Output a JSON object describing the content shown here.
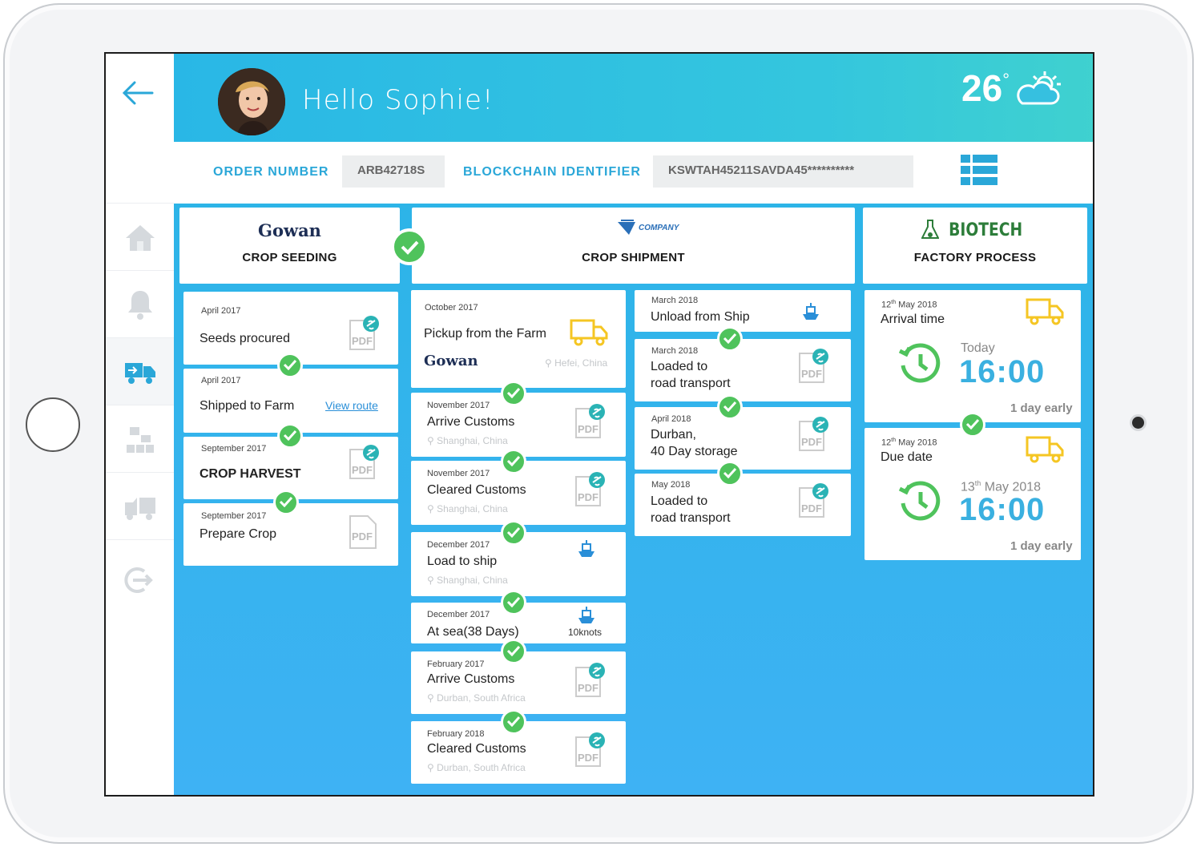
{
  "header": {
    "greeting": "Hello Sophie!",
    "temperature": "26",
    "degree_symbol": "°"
  },
  "order": {
    "order_label": "ORDER NUMBER",
    "order_value": "ARB42718S",
    "chain_label": "BLOCKCHAIN IDENTIFIER",
    "chain_value": "KSWTAH45211SAVDA45**********"
  },
  "columns": {
    "seeding": {
      "logo": "Gowan",
      "title": "CROP SEEDING"
    },
    "shipment": {
      "logo": "COMPANY",
      "title": "CROP SHIPMENT"
    },
    "factory": {
      "logo": "BIOTECH",
      "title": "FACTORY PROCESS"
    }
  },
  "seeding_cards": [
    {
      "date": "April 2017",
      "title": "Seeds procured"
    },
    {
      "date": "April 2017",
      "title": "Shipped to Farm",
      "link": "View route"
    },
    {
      "date": "September 2017",
      "title": "CROP HARVEST"
    },
    {
      "date": "September 2017",
      "title": "Prepare Crop"
    }
  ],
  "shipment_cards": [
    {
      "date": "October 2017",
      "title": "Pickup from the Farm",
      "logo": "Gowan",
      "location": "Hefei, China"
    },
    {
      "date": "November 2017",
      "title": "Arrive Customs",
      "location": "Shanghai, China"
    },
    {
      "date": "November 2017",
      "title": "Cleared Customs",
      "location": "Shanghai, China"
    },
    {
      "date": "December 2017",
      "title": "Load to ship",
      "location": "Shanghai, China"
    },
    {
      "date": "December 2017",
      "title": "At sea(38 Days)",
      "speed": "10knots"
    },
    {
      "date": "February 2017",
      "title": "Arrive Customs",
      "location": "Durban, South Africa"
    },
    {
      "date": "February 2018",
      "title": "Cleared Customs",
      "location": "Durban, South Africa"
    }
  ],
  "transport_cards": [
    {
      "date": "March 2018",
      "title": "Unload from Ship"
    },
    {
      "date": "March 2018",
      "title_line1": "Loaded to",
      "title_line2": "road transport"
    },
    {
      "date": "April 2018",
      "title_line1": "Durban,",
      "title_line2": "40 Day storage"
    },
    {
      "date": "May 2018",
      "title_line1": "Loaded to",
      "title_line2": "road transport"
    }
  ],
  "factory_cards": [
    {
      "date_day": "12",
      "date_sup": "th",
      "date_rest": "May 2018",
      "title": "Arrival time",
      "when": "Today",
      "time": "16:00",
      "note": "1 day early"
    },
    {
      "date_day": "12",
      "date_sup": "th",
      "date_rest": "May 2018",
      "title": "Due date",
      "when_day": "13",
      "when_sup": "th",
      "when_rest": "May 2018",
      "time": "16:00",
      "note": "1 day early"
    }
  ],
  "pdf_label": "PDF",
  "colors": {
    "accent": "#2aa7d8",
    "check": "#4fc35c",
    "truck": "#f5c623",
    "header_start": "#29b7e6",
    "header_end": "#3fd1cf"
  }
}
